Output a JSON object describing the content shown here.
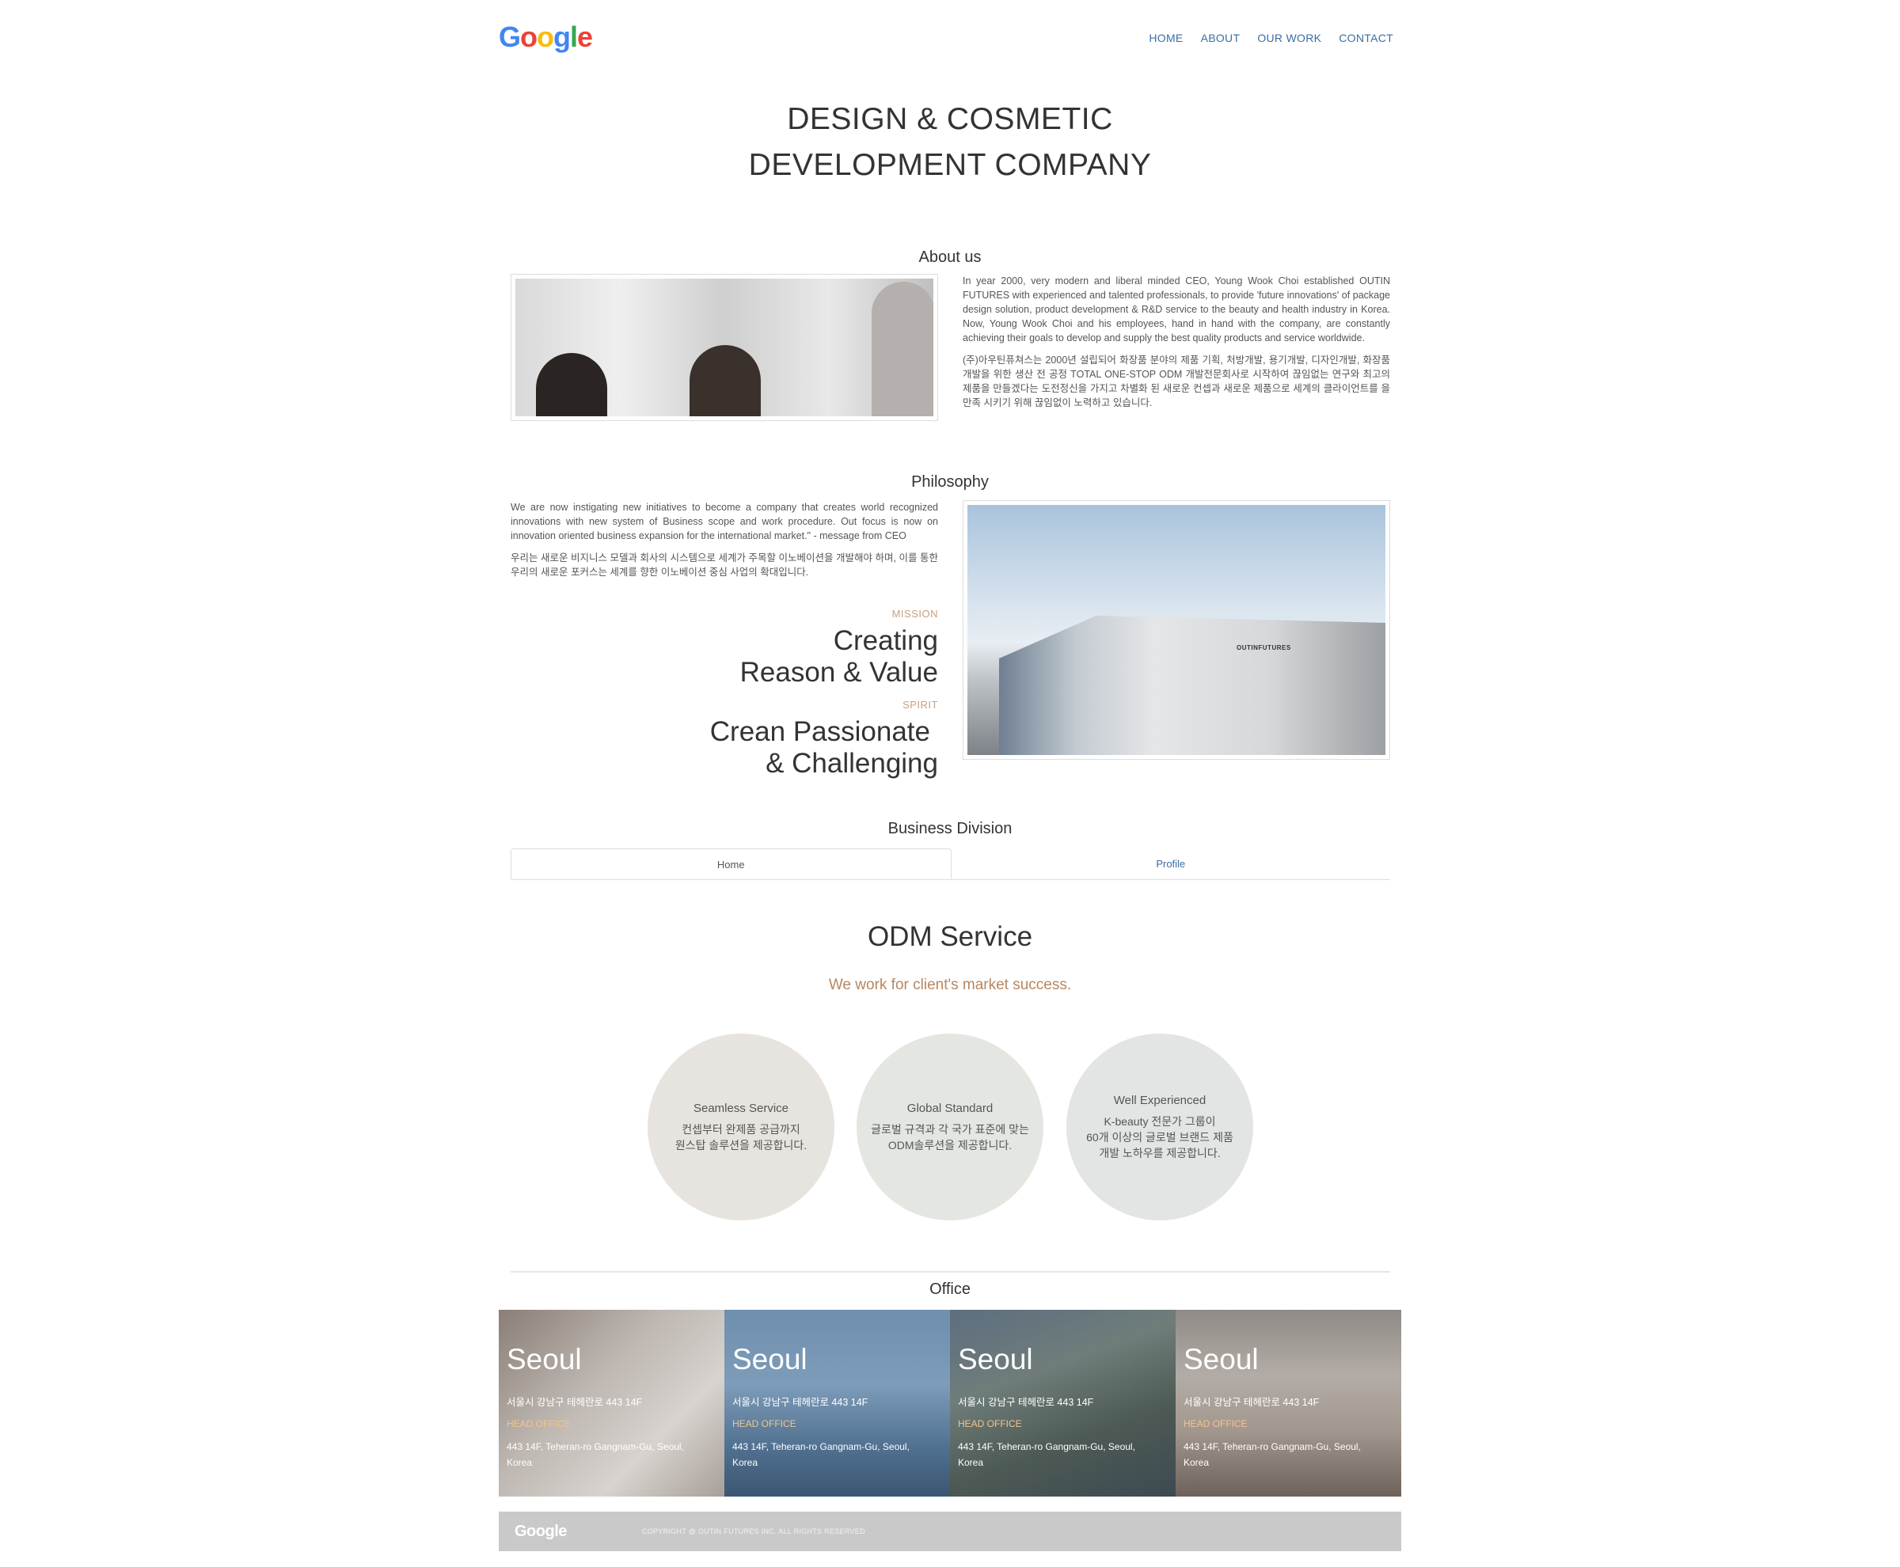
{
  "header": {
    "logo_text": "Google",
    "nav": [
      "HOME",
      "ABOUT",
      "OUR WORK",
      "CONTACT"
    ]
  },
  "hero": {
    "line1": "DESIGN & COSMETIC",
    "line2": "DEVELOPMENT COMPANY"
  },
  "about": {
    "title": "About us",
    "text_en": "In year 2000, very modern and liberal minded CEO, Young Wook Choi established OUTIN FUTURES with experienced and talented professionals, to provide 'future innovations' of package design solution, product development & R&D service to the beauty and health industry in Korea. Now, Young Wook Choi and his employees, hand in hand with the company, are constantly achieving their goals to develop and supply the best quality products and service worldwide.",
    "text_kr": "(주)아우틴퓨쳐스는 2000년 설립되어 화장품 분야의 제품 기획, 처방개발, 용기개발, 디자인개발, 화장품개발을 위한 생산 전 공정 TOTAL ONE-STOP ODM 개발전문회사로 시작하여 끊임없는 연구와 최고의 제품을 만들겠다는 도전정신을 가지고 차별화 된 새로운 컨셉과 새로운 제품으로 세계의 클라이언트를 을 만족 시키기 위해 끊임없이 노력하고 있습니다."
  },
  "philosophy": {
    "title": "Philosophy",
    "text_en": "We are now instigating new initiatives to become a company that creates world recognized innovations with new system of Business scope and work procedure. Out focus is now on innovation oriented business expansion for the international market.\" - message from CEO",
    "text_kr": "우리는 새로운 비지니스 모델과 회사의 시스템으로 세계가 주목할 이노베이션을 개발해야 하며, 이를 통한 우리의 새로운 포커스는 세계를 향한 이노베이션 중심 사업의 확대입니다.",
    "mission_label": "MISSION",
    "mission_line1": "Creating",
    "mission_line2": "Reason & Value",
    "spirit_label": "SPIRIT",
    "spirit_line1": "Crean Passionate",
    "spirit_line2": "& Challenging",
    "building_sign": "OUTINFUTURES"
  },
  "business": {
    "title": "Business Division",
    "tabs": [
      "Home",
      "Profile"
    ]
  },
  "odm": {
    "title": "ODM Service",
    "subtitle": "We work for client's market success.",
    "circles": [
      {
        "title": "Seamless Service",
        "desc1": "컨셉부터 완제품 공급까지",
        "desc2": "원스탑 솔루션을 제공합니다.",
        "desc3": "",
        "color": "#e7e4df"
      },
      {
        "title": "Global Standard",
        "desc1": "글로벌 규격과 각 국가 표준에 맞는",
        "desc2": "ODM솔루션을 제공합니다.",
        "desc3": "",
        "color": "#e3e6e1"
      },
      {
        "title": "Well Experienced",
        "desc1": "K-beauty 전문가 그룹이",
        "desc2": "60개 이상의 글로벌 브랜드 제품",
        "desc3": "개발 노하우를 제공합니다.",
        "color": "#e3e5e5"
      }
    ]
  },
  "office": {
    "title": "Office",
    "cards": [
      {
        "city": "Seoul",
        "addr_kr": "서울시 강남구 테헤란로 443 14F",
        "hq": "HEAD OFFICE",
        "addr_en1": "443 14F, Teheran-ro Gangnam-Gu, Seoul,",
        "addr_en2": "Korea"
      },
      {
        "city": "Seoul",
        "addr_kr": "서울시 강남구 테헤란로 443 14F",
        "hq": "HEAD OFFICE",
        "addr_en1": "443 14F, Teheran-ro Gangnam-Gu, Seoul,",
        "addr_en2": "Korea"
      },
      {
        "city": "Seoul",
        "addr_kr": "서울시 강남구 테헤란로 443 14F",
        "hq": "HEAD OFFICE",
        "addr_en1": "443 14F, Teheran-ro Gangnam-Gu, Seoul,",
        "addr_en2": "Korea"
      },
      {
        "city": "Seoul",
        "addr_kr": "서울시 강남구 테헤란로 443 14F",
        "hq": "HEAD OFFICE",
        "addr_en1": "443 14F, Teheran-ro Gangnam-Gu, Seoul,",
        "addr_en2": "Korea"
      }
    ]
  },
  "footer": {
    "logo_text": "Google",
    "copyright": "COPYRIGHT @ OUTIN FUTURES INC. ALL RIGHTS RESERVED"
  },
  "colors": {
    "nav_link": "#3a6ea5",
    "accent_brown": "#b8865f",
    "mission_label": "#c8a080",
    "footer_bg": "#c9c9c9"
  }
}
